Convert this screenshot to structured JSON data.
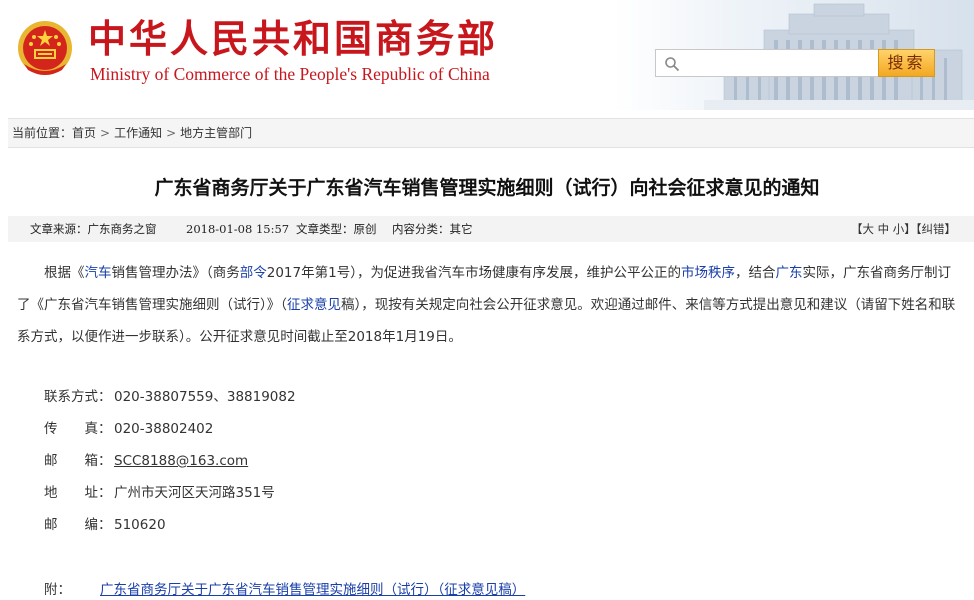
{
  "header": {
    "title_cn": "中华人民共和国商务部",
    "title_en": "Ministry of Commerce of the People's Republic of China",
    "search_placeholder": "",
    "search_button": "搜索",
    "brand_color": "#c8161d"
  },
  "breadcrumb": {
    "label": "当前位置：",
    "items": [
      "首页",
      "工作通知",
      "地方主管部门"
    ],
    "separator": ">"
  },
  "article": {
    "title": "广东省商务厅关于广东省汽车销售管理实施细则（试行）向社会征求意见的通知",
    "meta": {
      "source": "文章来源：广东商务之窗",
      "date": "2018-01-08 15:57",
      "type": "文章类型：原创",
      "category": "内容分类：其它"
    },
    "font_controls": {
      "open": "【",
      "large": "大",
      "medium": "中",
      "small": "小",
      "mid": "】【",
      "error": "纠错",
      "close": "】"
    },
    "body": {
      "p1": "根据《",
      "kw1": "汽车",
      "p2": "销售管理办法》（商务",
      "kw2": "部令",
      "p3": "2017年第1号），为促进我省汽车市场健康有序发展，维护公平公正的",
      "kw3": "市场秩序",
      "p4": "，结合",
      "kw4": "广东",
      "p5": "实际，广东省商务厅制订了《广东省汽车销售管理实施细则（试行）》（",
      "kw5": "征求意见",
      "p6": "稿），现按有关规定向社会公开征求意见。欢迎通过邮件、来信等方式提出意见和建议（请留下姓名和联系方式，以便作进一步联系）。公开征求意见时间截止至2018年1月19日。"
    },
    "contacts": [
      {
        "label": "联系方式：",
        "value": "020-38807559、38819082"
      },
      {
        "label": "传　　真：",
        "value": "020-38802402"
      },
      {
        "label": "邮　　箱：",
        "value": "SCC8188@163.com"
      },
      {
        "label": "地　　址：",
        "value": "广州市天河区天河路351号"
      },
      {
        "label": "邮　　编：",
        "value": "510620"
      }
    ],
    "attachment": {
      "label": "附：",
      "link": "广东省商务厅关于广东省汽车销售管理实施细则（试行）（征求意见稿）"
    }
  }
}
